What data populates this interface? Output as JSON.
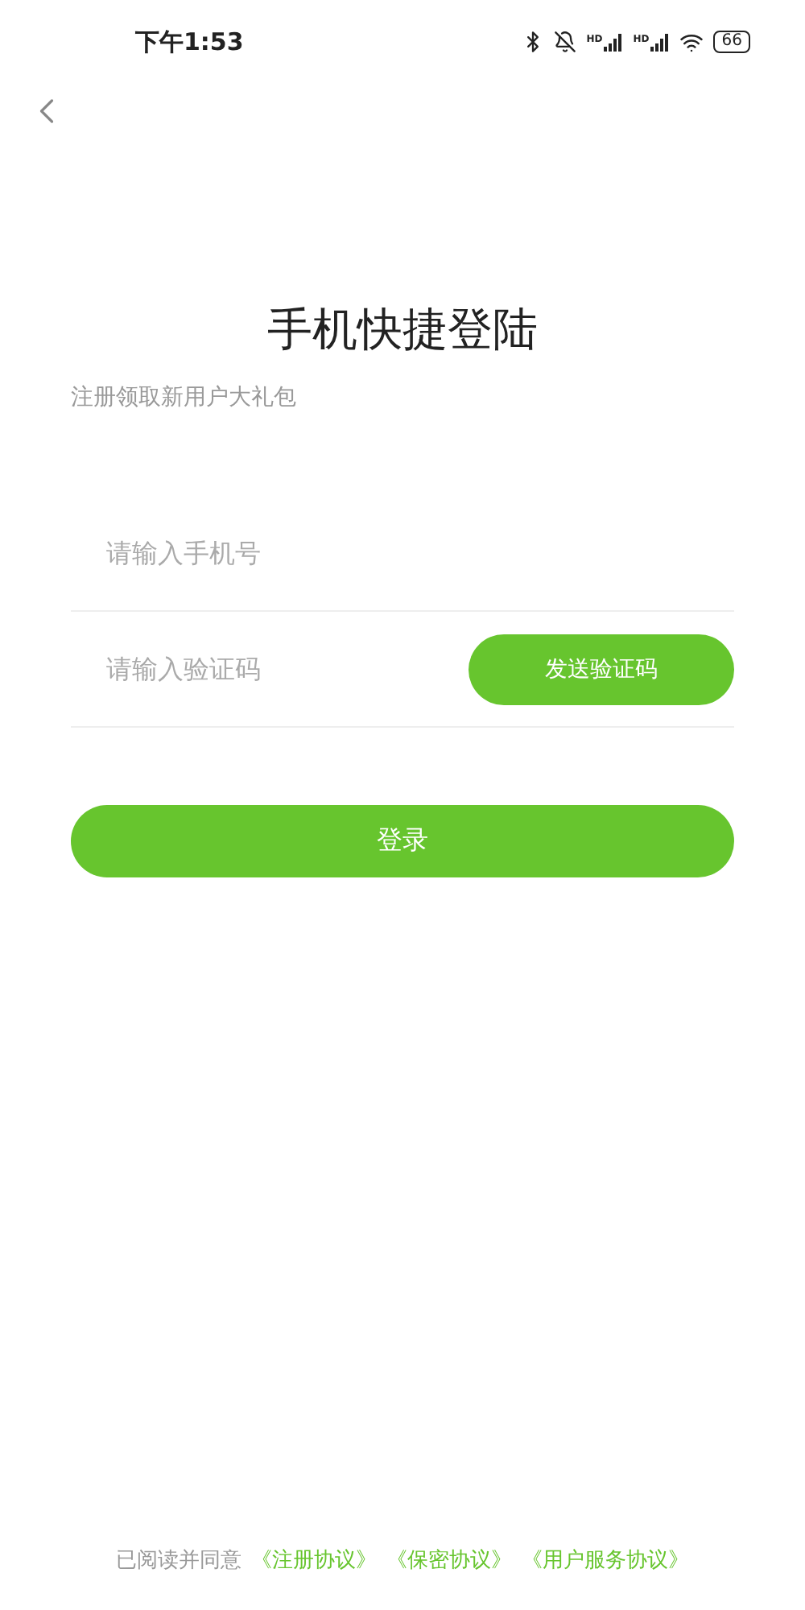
{
  "status_bar": {
    "time": "下午1:53",
    "signal_labels": [
      "HD",
      "HD"
    ],
    "battery": "66"
  },
  "title": "手机快捷登陆",
  "subtitle": "注册领取新用户大礼包",
  "phone_field": {
    "placeholder": "请输入手机号"
  },
  "code_field": {
    "placeholder": "请输入验证码"
  },
  "send_code_button": "发送验证码",
  "login_button": "登录",
  "footer": {
    "text": "已阅读并同意",
    "links": [
      "《注册协议》",
      "《保密协议》",
      "《用户服务协议》"
    ]
  }
}
